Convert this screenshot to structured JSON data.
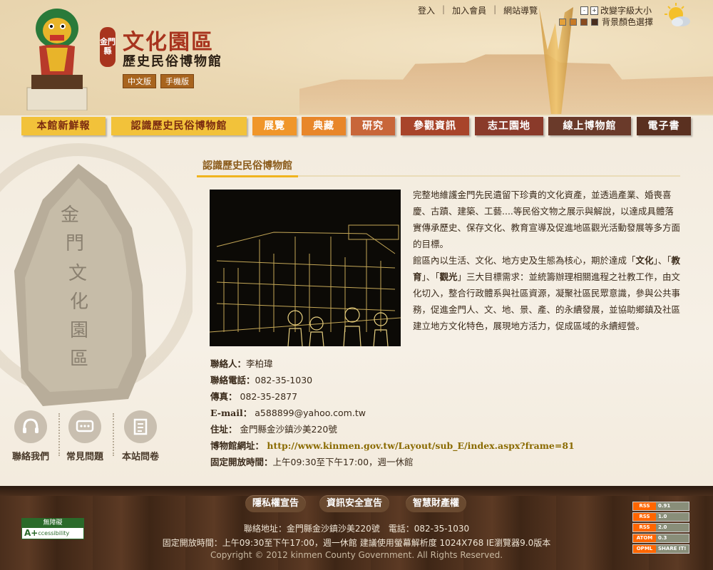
{
  "header": {
    "badge": "金門縣",
    "title": "文化園區",
    "subtitle": "歷史民俗博物館",
    "lang_links": [
      "中文版",
      "手機版"
    ],
    "top_links": [
      "登入",
      "加入會員",
      "網站導覽"
    ],
    "font_size_label": "改變字級大小",
    "bg_color_label": "背景顏色選擇",
    "bg_colors": [
      "#e5a13a",
      "#c77a28",
      "#8a4a1e",
      "#4a2e1e"
    ]
  },
  "nav": [
    {
      "label": "本館新鮮報",
      "color": "#f2c23a",
      "text": "#7a2a10"
    },
    {
      "label": "認識歷史民俗博物館",
      "color": "#f2c23a",
      "text": "#7a2a10"
    },
    {
      "label": "展覽",
      "color": "#f0962a",
      "text": "#ffffff"
    },
    {
      "label": "典藏",
      "color": "#e8862a",
      "text": "#ffffff"
    },
    {
      "label": "研究",
      "color": "#c8663a",
      "text": "#ffffff"
    },
    {
      "label": "參觀資訊",
      "color": "#a8442a",
      "text": "#ffffff"
    },
    {
      "label": "志工園地",
      "color": "#8a3a2a",
      "text": "#ffffff"
    },
    {
      "label": "線上博物館",
      "color": "#6a3a2a",
      "text": "#ffffff"
    },
    {
      "label": "電子書",
      "color": "#5a3020",
      "text": "#ffffff"
    }
  ],
  "quick_links": [
    "聯絡我們",
    "常見問題",
    "本站問卷"
  ],
  "rock_text": "金門文化園區",
  "page": {
    "title": "認識歷史民俗博物館",
    "para1": "完整地維護金門先民遺留下珍貴的文化資產，並透過產業、婚喪喜慶、古蹟、建築、工藝....等民俗文物之展示與解說，以達成具體落實傳承歷史、保存文化、教育宣導及促進地區觀光活動發展等多方面的目標。",
    "para2_a": "館區內以生活、文化、地方史及生態為核心，期於達成「",
    "para2_b1": "文化",
    "para2_c": "」、「",
    "para2_b2": "教育",
    "para2_d": "」、「",
    "para2_b3": "觀光",
    "para2_e": "」三大目標需求：並統籌辦理相關進程之社教工作，由文化切入，整合行政體系與社區資源，凝聚社區民眾意識，參與公共事務，促進金門人、文、地、景、產、的永續發展，並協助鄉鎮及社區建立地方文化特色，展現地方活力，促成區域的永續經營。",
    "contact": [
      {
        "label": "聯絡人：",
        "value": "李柏瑋"
      },
      {
        "label": "聯絡電話：",
        "value": "082-35-1030"
      },
      {
        "label": "傳真：",
        "value": " 082-35-2877"
      },
      {
        "label": "E-mail：",
        "value": " a588899@yahoo.com.tw"
      },
      {
        "label": "住址：",
        "value": " 金門縣金沙鎮沙美220號"
      },
      {
        "label": "博物館網址：",
        "value": " http://www.kinmen.gov.tw/Layout/sub_E/index.aspx?frame=81"
      },
      {
        "label": "固定開放時間：",
        "value": "上午09:30至下午17:00，週一休館"
      }
    ]
  },
  "footer": {
    "buttons": [
      "隱私權宣告",
      "資訊安全宣告",
      "智慧財產權"
    ],
    "address": "聯絡地址：金門縣金沙鎮沙美220號　電話：082-35-1030",
    "hours": "固定開放時間：上午09:30至下午17:00，週一休館  建議使用螢幕解析度 1024X768  IE瀏覽器9.0版本",
    "copyright": "Copyright © 2012 kinmen County Government. All Rights Reserved.",
    "accessibility_a": "無障礙",
    "accessibility_b": "A+",
    "accessibility_c": "ccessibility",
    "rss": [
      {
        "a": "RSS",
        "b": "0.91"
      },
      {
        "a": "RSS",
        "b": "1.0"
      },
      {
        "a": "RSS",
        "b": "2.0"
      },
      {
        "a": "ATOM",
        "b": "0.3"
      },
      {
        "a": "OPML",
        "b": "SHARE IT!"
      }
    ]
  }
}
